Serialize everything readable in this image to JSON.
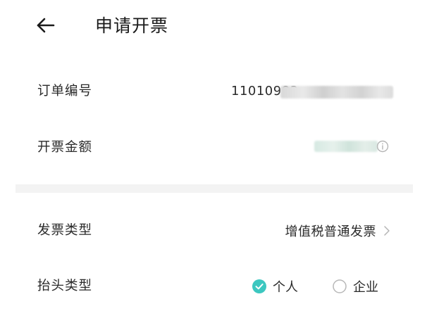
{
  "header": {
    "back_icon": "arrow-left-icon",
    "title": "申请开票"
  },
  "order": {
    "label": "订单编号",
    "value_visible": "11010983"
  },
  "amount": {
    "label": "开票金额",
    "icon": "info-circle-icon"
  },
  "invoice_type": {
    "label": "发票类型",
    "value": "增值税普通发票",
    "icon": "chevron-right-icon"
  },
  "title_type": {
    "label": "抬头类型",
    "options": [
      {
        "label": "个人",
        "selected": true
      },
      {
        "label": "企业",
        "selected": false
      }
    ]
  },
  "colors": {
    "accent": "#3cc7c0",
    "text": "#2a2a2a",
    "muted": "#b5b5b5",
    "divider": "#f3f3f3"
  }
}
